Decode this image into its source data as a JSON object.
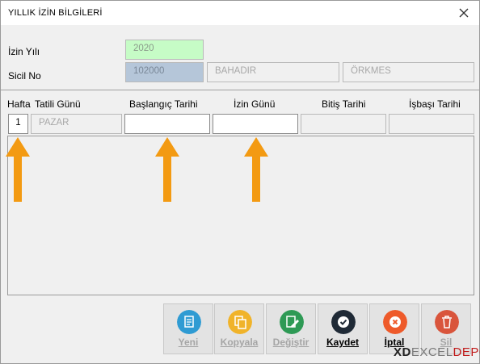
{
  "window": {
    "title": "YILLIK İZİN BİLGİLERİ"
  },
  "form": {
    "izin_yili_label": "İzin Yılı",
    "izin_yili_value": "2020",
    "sicil_no_label": "Sicil No",
    "sicil_no_value": "102000",
    "first_name": "BAHADIR",
    "last_name": "ÖRKMES"
  },
  "columns": {
    "hafta": "Hafta",
    "tatili_gunu": "Tatili Günü",
    "baslangic": "Başlangıç Tarihi",
    "izin_gunu": "İzin Günü",
    "bitis": "Bitiş Tarihi",
    "isbasi": "İşbaşı Tarihi"
  },
  "row": {
    "hafta_no": "1",
    "tatil_gunu": "PAZAR",
    "baslangic_tarihi": "",
    "izin_gunu": "",
    "bitis_tarihi": "",
    "isbasi_tarihi": ""
  },
  "buttons": [
    {
      "label": "Yeni",
      "icon": "document-icon",
      "color": "#2f9bd3",
      "enabled": false
    },
    {
      "label": "Kopyala",
      "icon": "copy-icon",
      "color": "#f0b32a",
      "enabled": false
    },
    {
      "label": "Değiştir",
      "icon": "edit-icon",
      "color": "#2e9a55",
      "enabled": false
    },
    {
      "label": "Kaydet",
      "icon": "check-icon",
      "color": "#1f2a36",
      "enabled": true
    },
    {
      "label": "İptal",
      "icon": "cancel-icon",
      "color": "#ee5a2a",
      "enabled": true
    },
    {
      "label": "Sil",
      "icon": "trash-icon",
      "color": "#d9553c",
      "enabled": false
    }
  ],
  "annotations": {
    "arrow_color": "#f39a12"
  },
  "brand": {
    "text": "XDEXCELDEPO",
    "prefix": "XD",
    "middle": "EXCEL",
    "suffix": "DEPO"
  }
}
